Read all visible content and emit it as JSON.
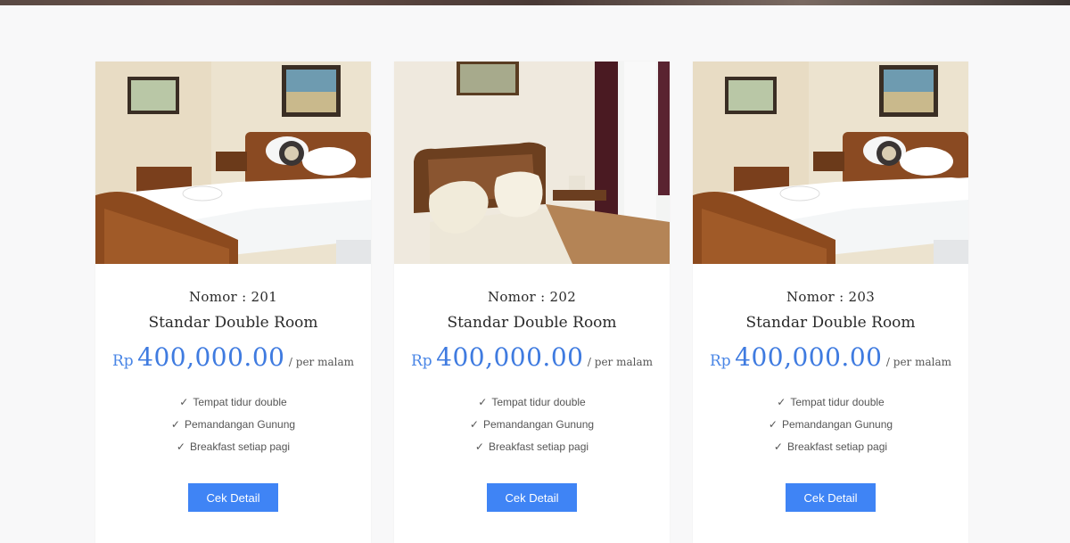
{
  "rooms": [
    {
      "number_label": "Nomor : 201",
      "name": "Standar Double Room",
      "currency": "Rp",
      "price": "400,000.00",
      "unit": "/ per malam",
      "features": [
        "Tempat tidur double",
        "Pemandangan Gunung",
        "Breakfast setiap pagi"
      ],
      "button_label": "Cek Detail"
    },
    {
      "number_label": "Nomor : 202",
      "name": "Standar Double Room",
      "currency": "Rp",
      "price": "400,000.00",
      "unit": "/ per malam",
      "features": [
        "Tempat tidur double",
        "Pemandangan Gunung",
        "Breakfast setiap pagi"
      ],
      "button_label": "Cek Detail"
    },
    {
      "number_label": "Nomor : 203",
      "name": "Standar Double Room",
      "currency": "Rp",
      "price": "400,000.00",
      "unit": "/ per malam",
      "features": [
        "Tempat tidur double",
        "Pemandangan Gunung",
        "Breakfast setiap pagi"
      ],
      "button_label": "Cek Detail"
    }
  ],
  "colors": {
    "accent": "#3f84f5",
    "price": "#3f7be0",
    "background": "#f8f8f9"
  },
  "icons": {
    "feature": "check-icon"
  }
}
